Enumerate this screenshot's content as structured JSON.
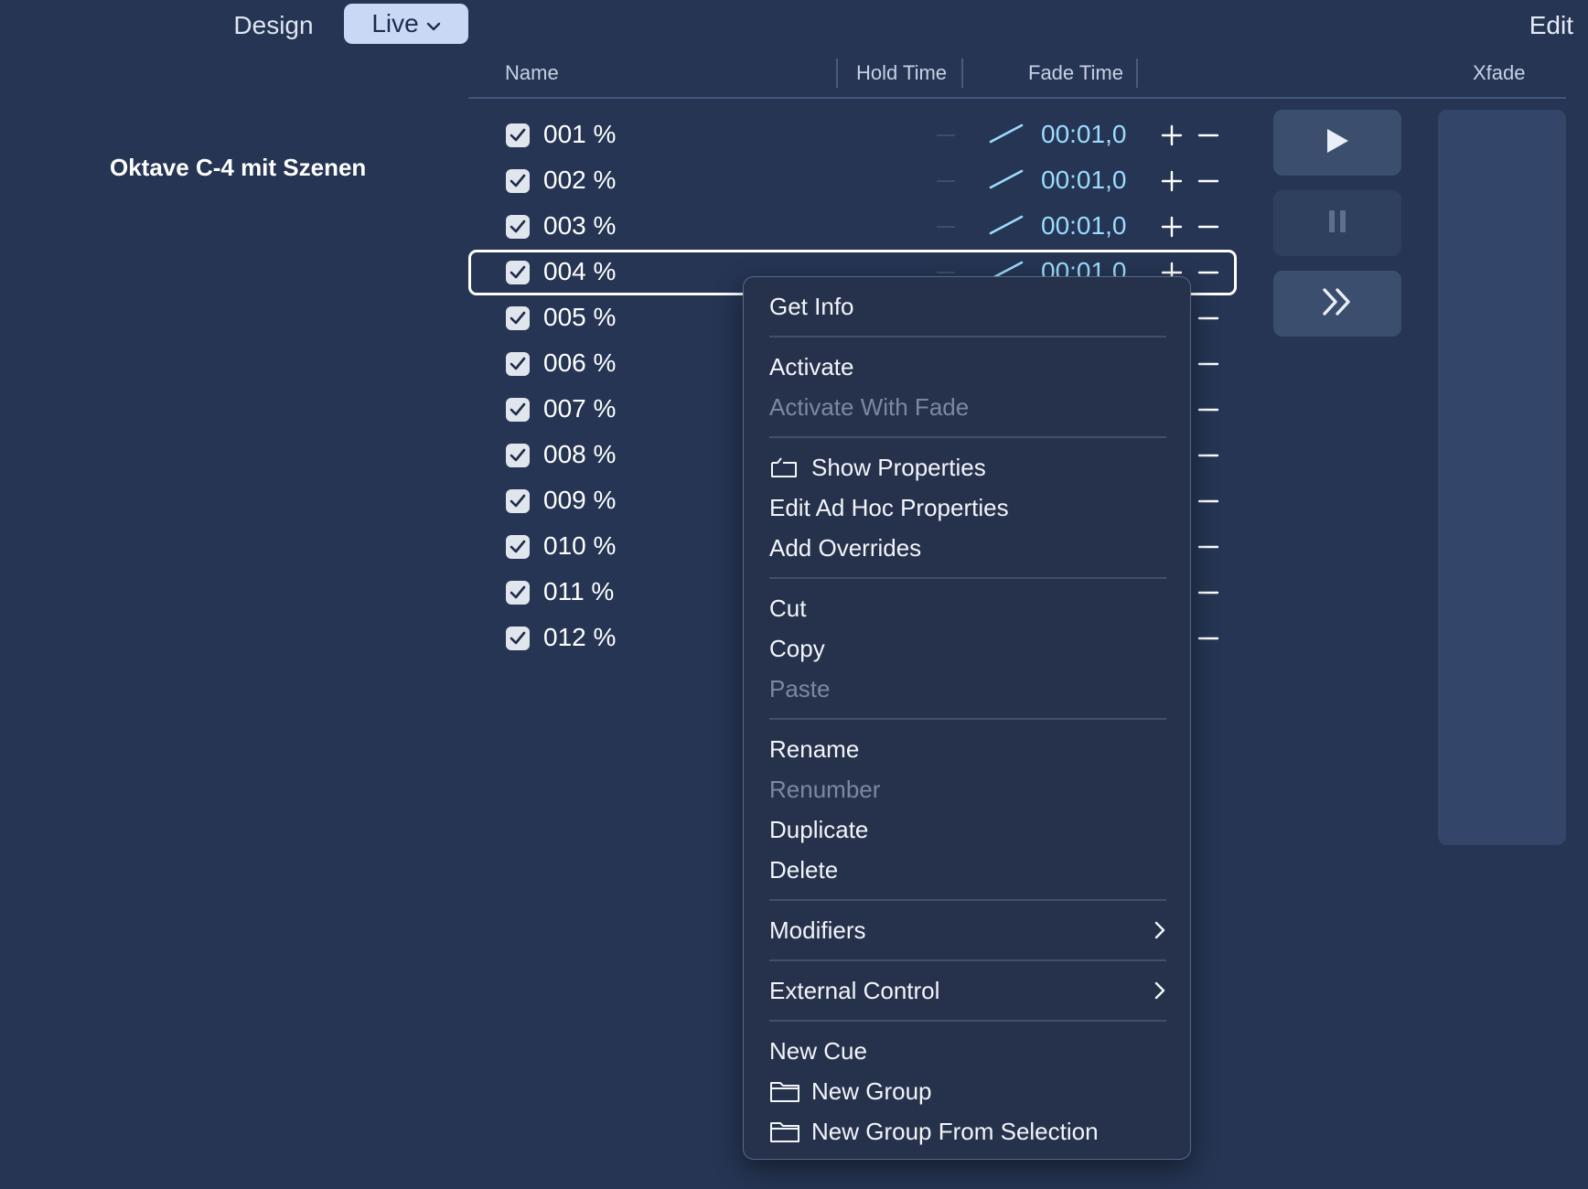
{
  "topbar": {
    "design_tab": "Design",
    "live_tab": "Live",
    "edit_label": "Edit"
  },
  "header": {
    "name": "Name",
    "hold_time": "Hold Time",
    "fade_time": "Fade Time",
    "xfade": "Xfade"
  },
  "cue_list": {
    "title": "Oktave C-4 mit Szenen",
    "rows": [
      {
        "name": "001 %",
        "fade": "00:01,0"
      },
      {
        "name": "002 %",
        "fade": "00:01,0"
      },
      {
        "name": "003 %",
        "fade": "00:01,0"
      },
      {
        "name": "004 %",
        "fade": "00:01,0"
      },
      {
        "name": "005 %"
      },
      {
        "name": "006 %"
      },
      {
        "name": "007 %"
      },
      {
        "name": "008 %"
      },
      {
        "name": "009 %"
      },
      {
        "name": "010 %"
      },
      {
        "name": "011 %"
      },
      {
        "name": "012 %"
      }
    ]
  },
  "menu": {
    "get_info": "Get Info",
    "activate": "Activate",
    "activate_with_fade": "Activate With Fade",
    "show_properties": "Show Properties",
    "edit_ad_hoc": "Edit Ad Hoc Properties",
    "add_overrides": "Add Overrides",
    "cut": "Cut",
    "copy": "Copy",
    "paste": "Paste",
    "rename": "Rename",
    "renumber": "Renumber",
    "duplicate": "Duplicate",
    "delete": "Delete",
    "modifiers": "Modifiers",
    "external_control": "External Control",
    "new_cue": "New Cue",
    "new_group": "New Group",
    "new_group_from_selection": "New Group From Selection"
  },
  "colors": {
    "background": "#253553",
    "fade_time": "#9bdcff",
    "live_tab_bg": "#c9d8f5"
  }
}
